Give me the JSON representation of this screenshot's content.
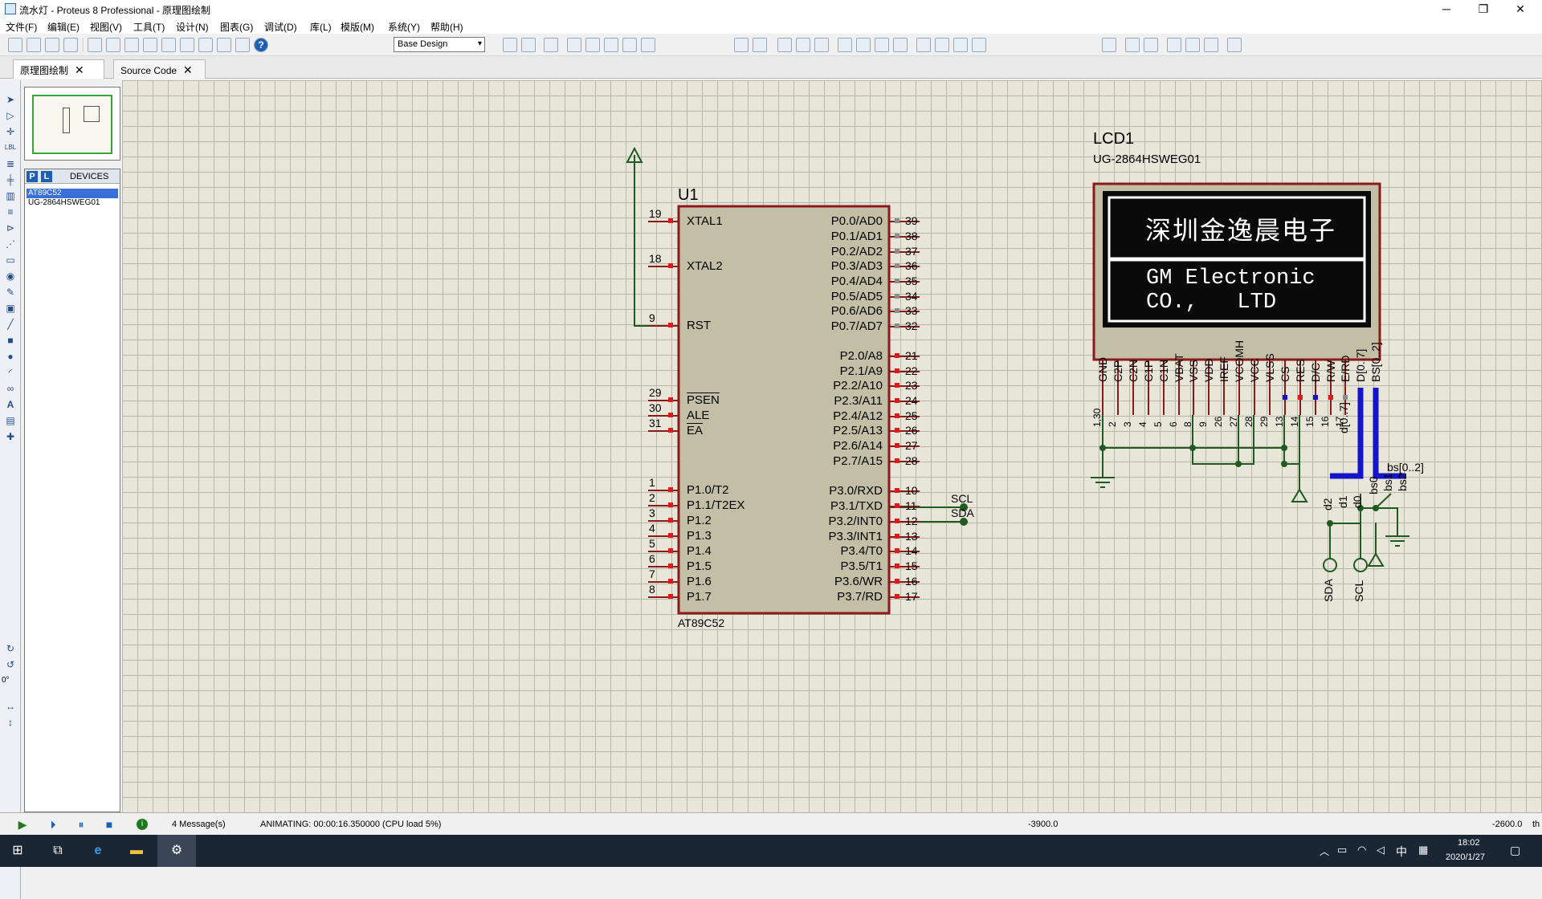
{
  "window": {
    "title": "流水灯 - Proteus 8 Professional - 原理图绘制",
    "controls": [
      "─",
      "❐",
      "✕"
    ]
  },
  "menu": [
    "文件(F)",
    "编辑(E)",
    "视图(V)",
    "工具(T)",
    "设计(N)",
    "图表(G)",
    "调试(D)",
    "库(L)",
    "模版(M)",
    "系统(Y)",
    "帮助(H)"
  ],
  "toolbar": {
    "design_select": "Base Design"
  },
  "tabs": [
    {
      "label": "原理图绘制",
      "close": "✕"
    },
    {
      "label": "Source Code",
      "close": "✕"
    }
  ],
  "toolbox": {
    "rotation": "0°"
  },
  "devices": {
    "mode_p": "P",
    "mode_l": "L",
    "title": "DEVICES",
    "items": [
      "AT89C52",
      "UG-2864HSWEG01"
    ]
  },
  "schematic": {
    "u1": {
      "ref": "U1",
      "part": "AT89C52",
      "left_pins": [
        {
          "num": "19",
          "name": "XTAL1"
        },
        {
          "num": "18",
          "name": "XTAL2"
        },
        {
          "num": "9",
          "name": "RST"
        },
        {
          "num": "29",
          "name": "PSEN"
        },
        {
          "num": "30",
          "name": "ALE"
        },
        {
          "num": "31",
          "name": "EA"
        },
        {
          "num": "1",
          "name": "P1.0/T2"
        },
        {
          "num": "2",
          "name": "P1.1/T2EX"
        },
        {
          "num": "3",
          "name": "P1.2"
        },
        {
          "num": "4",
          "name": "P1.3"
        },
        {
          "num": "5",
          "name": "P1.4"
        },
        {
          "num": "6",
          "name": "P1.5"
        },
        {
          "num": "7",
          "name": "P1.6"
        },
        {
          "num": "8",
          "name": "P1.7"
        }
      ],
      "right_pins": [
        {
          "num": "39",
          "name": "P0.0/AD0"
        },
        {
          "num": "38",
          "name": "P0.1/AD1"
        },
        {
          "num": "37",
          "name": "P0.2/AD2"
        },
        {
          "num": "36",
          "name": "P0.3/AD3"
        },
        {
          "num": "35",
          "name": "P0.4/AD4"
        },
        {
          "num": "34",
          "name": "P0.5/AD5"
        },
        {
          "num": "33",
          "name": "P0.6/AD6"
        },
        {
          "num": "32",
          "name": "P0.7/AD7"
        },
        {
          "num": "21",
          "name": "P2.0/A8"
        },
        {
          "num": "22",
          "name": "P2.1/A9"
        },
        {
          "num": "23",
          "name": "P2.2/A10"
        },
        {
          "num": "24",
          "name": "P2.3/A11"
        },
        {
          "num": "25",
          "name": "P2.4/A12"
        },
        {
          "num": "26",
          "name": "P2.5/A13"
        },
        {
          "num": "27",
          "name": "P2.6/A14"
        },
        {
          "num": "28",
          "name": "P2.7/A15"
        },
        {
          "num": "10",
          "name": "P3.0/RXD"
        },
        {
          "num": "11",
          "name": "P3.1/TXD"
        },
        {
          "num": "12",
          "name": "P3.2/INT0"
        },
        {
          "num": "13",
          "name": "P3.3/INT1"
        },
        {
          "num": "14",
          "name": "P3.4/T0"
        },
        {
          "num": "15",
          "name": "P3.5/T1"
        },
        {
          "num": "16",
          "name": "P3.6/WR"
        },
        {
          "num": "17",
          "name": "P3.7/RD"
        }
      ],
      "net_labels": [
        "SCL",
        "SDA"
      ]
    },
    "lcd": {
      "ref": "LCD1",
      "part": "UG-2864HSWEG01",
      "line1": "深圳金逸晨电子",
      "line2": "GM Electronic",
      "line3": "CO.,   LTD",
      "pins": [
        {
          "num": "1,30",
          "name": "GND"
        },
        {
          "num": "2",
          "name": "C2P"
        },
        {
          "num": "3",
          "name": "C2N"
        },
        {
          "num": "4",
          "name": "C1P"
        },
        {
          "num": "5",
          "name": "C1N"
        },
        {
          "num": "6",
          "name": "VBAT"
        },
        {
          "num": "8",
          "name": "VSS"
        },
        {
          "num": "9",
          "name": "VDD"
        },
        {
          "num": "26",
          "name": "IREF"
        },
        {
          "num": "27",
          "name": "VCOMH"
        },
        {
          "num": "28",
          "name": "VCC"
        },
        {
          "num": "29",
          "name": "VLSS"
        },
        {
          "num": "13",
          "name": "CS"
        },
        {
          "num": "14",
          "name": "RES"
        },
        {
          "num": "15",
          "name": "D/C"
        },
        {
          "num": "16",
          "name": "R/W"
        },
        {
          "num": "17",
          "name": "E/RD"
        },
        {
          "num": "",
          "name": "D[0..7]"
        },
        {
          "num": "",
          "name": "BS[0..2]"
        }
      ],
      "bus_labels": {
        "d": "d[0..7]",
        "bs": "bs[0..2]"
      },
      "bus_entries": [
        "d2",
        "d1",
        "d0",
        "bs0",
        "bs1",
        "bs2"
      ],
      "terminals": [
        "SDA",
        "SCL"
      ]
    }
  },
  "status": {
    "messages": "4 Message(s)",
    "animating": "ANIMATING: 00:00:16.350000 (CPU load 5%)",
    "coord_x": "-3900.0",
    "coord_y": "-2600.0",
    "unit": "th"
  },
  "taskbar": {
    "time": "18:02",
    "date": "2020/1/27",
    "ime": "中"
  }
}
